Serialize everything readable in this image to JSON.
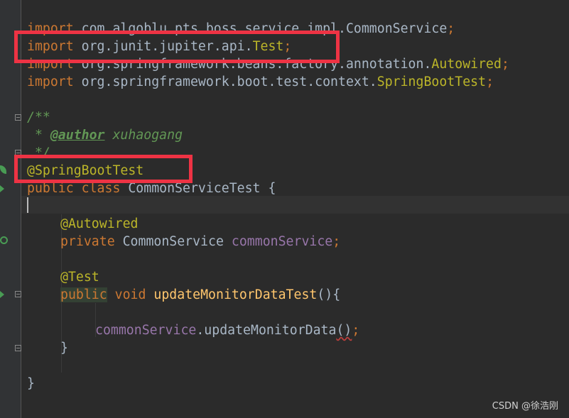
{
  "editor": {
    "lines": {
      "l0": {
        "kw": "import",
        "rest": " com.algoblu.pts.boss.service.impl.CommonService",
        "semi": ";"
      },
      "l1": {
        "kw": "import",
        "rest": " org.junit.jupiter.api.",
        "cls": "Test",
        "semi": ";"
      },
      "l2": {
        "kw": "import",
        "rest": " org.springframework.beans.factory.annotation.",
        "cls": "Autowired",
        "semi": ";"
      },
      "l3": {
        "kw": "import",
        "rest": " org.springframework.boot.test.context.",
        "cls": "SpringBootTest",
        "semi": ";"
      },
      "l5": "/**",
      "l6a": " * ",
      "l6tag": "@author",
      "l6b": " xuhaogang",
      "l7": " */",
      "l8": "@SpringBootTest",
      "l9": {
        "kw": "public class",
        "rest": " CommonServiceTest {"
      },
      "l11": "@Autowired",
      "l12": {
        "kw": "private",
        "type": " CommonService ",
        "field": "commonService",
        "semi": ";"
      },
      "l14": "@Test",
      "l15": {
        "kw1": "public",
        "kw2": " void ",
        "fn": "updateMonitorDataTest",
        "rest": "(){"
      },
      "l17": {
        "field": "commonService",
        "call": ".updateMonitorData",
        "paren": "()",
        "semi": ";"
      },
      "l18": "}",
      "l20": "}"
    }
  },
  "watermark": "CSDN @徐浩刚",
  "colors": {
    "background": "#2b2b2b",
    "keyword": "#cc7832",
    "annotation": "#bbb529",
    "field": "#9876aa",
    "method": "#ffc66d",
    "comment": "#629755",
    "highlight_box": "#ee3344"
  }
}
